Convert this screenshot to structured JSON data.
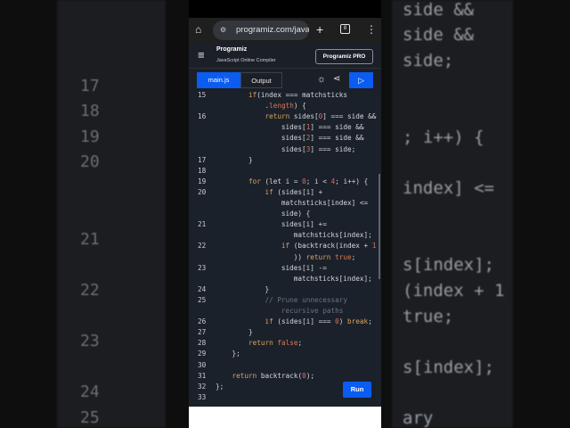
{
  "background": {
    "line_numbers": [
      "17",
      "18",
      "19",
      "20",
      "21",
      "22",
      "23",
      "24",
      "25"
    ],
    "code": [
      "side &&",
      "side &&",
      "side;",
      "; i++) {",
      "index] <=",
      "s[index];",
      "(index + 1",
      "true;",
      "s[index];",
      "ary"
    ]
  },
  "browser": {
    "url": "programiz.com/javasc",
    "tab_count": "8"
  },
  "header": {
    "logo": "Programiz",
    "subtitle": "JavaScript Online Compiler",
    "pro_button": "Programiz PRO"
  },
  "toolbar": {
    "tab_main": "main.js",
    "tab_output": "Output"
  },
  "editor": {
    "run_label": "Run",
    "rows": [
      {
        "ln": "15",
        "i": 8,
        "s": [
          [
            "k",
            "if"
          ],
          [
            "",
            "(index === matchsticks"
          ]
        ]
      },
      {
        "ln": "",
        "i": 12,
        "s": [
          [
            "",
            "."
          ],
          [
            "b",
            "length"
          ],
          [
            "",
            ") {"
          ]
        ]
      },
      {
        "ln": "16",
        "i": 12,
        "s": [
          [
            "k",
            "return"
          ],
          [
            "",
            " sides["
          ],
          [
            "n",
            "0"
          ],
          [
            "",
            "] === side &&"
          ]
        ]
      },
      {
        "ln": "",
        "i": 16,
        "s": [
          [
            "",
            "sides["
          ],
          [
            "n",
            "1"
          ],
          [
            "",
            "] === side &&"
          ]
        ]
      },
      {
        "ln": "",
        "i": 16,
        "s": [
          [
            "",
            "sides["
          ],
          [
            "n",
            "2"
          ],
          [
            "",
            "] === side &&"
          ]
        ]
      },
      {
        "ln": "",
        "i": 16,
        "s": [
          [
            "",
            "sides["
          ],
          [
            "n",
            "3"
          ],
          [
            "",
            "] === side;"
          ]
        ]
      },
      {
        "ln": "17",
        "i": 8,
        "s": [
          [
            "",
            "}"
          ]
        ]
      },
      {
        "ln": "18",
        "i": 0,
        "s": []
      },
      {
        "ln": "19",
        "i": 8,
        "s": [
          [
            "k",
            "for"
          ],
          [
            "",
            " (let i = "
          ],
          [
            "n",
            "0"
          ],
          [
            "",
            "; i < "
          ],
          [
            "n",
            "4"
          ],
          [
            "",
            "; i++) {"
          ]
        ]
      },
      {
        "ln": "20",
        "i": 12,
        "s": [
          [
            "k",
            "if"
          ],
          [
            "",
            " (sides[i] +"
          ]
        ]
      },
      {
        "ln": "",
        "i": 16,
        "s": [
          [
            "",
            "matchsticks[index] <="
          ]
        ]
      },
      {
        "ln": "",
        "i": 16,
        "s": [
          [
            "",
            "side) {"
          ]
        ]
      },
      {
        "ln": "21",
        "i": 16,
        "s": [
          [
            "",
            "sides[i] +="
          ]
        ]
      },
      {
        "ln": "",
        "i": 19,
        "s": [
          [
            "",
            "matchsticks[index];"
          ]
        ]
      },
      {
        "ln": "22",
        "i": 16,
        "s": [
          [
            "k",
            "if"
          ],
          [
            "",
            " (backtrack(index + "
          ],
          [
            "n",
            "1"
          ]
        ]
      },
      {
        "ln": "",
        "i": 19,
        "s": [
          [
            "",
            "))"
          ],
          [
            "k",
            " return"
          ],
          [
            "b",
            " true"
          ],
          [
            "",
            ";"
          ]
        ]
      },
      {
        "ln": "23",
        "i": 16,
        "s": [
          [
            "",
            "sides[i] -="
          ]
        ]
      },
      {
        "ln": "",
        "i": 19,
        "s": [
          [
            "",
            "matchsticks[index];"
          ]
        ]
      },
      {
        "ln": "24",
        "i": 12,
        "s": [
          [
            "",
            "}"
          ]
        ]
      },
      {
        "ln": "25",
        "i": 12,
        "s": [
          [
            "c",
            "// Prune unnecessary"
          ]
        ]
      },
      {
        "ln": "",
        "i": 16,
        "s": [
          [
            "c",
            "recursive paths"
          ]
        ]
      },
      {
        "ln": "26",
        "i": 12,
        "s": [
          [
            "k",
            "if"
          ],
          [
            "",
            " (sides[i] === "
          ],
          [
            "n",
            "0"
          ],
          [
            "",
            ") "
          ],
          [
            "k",
            "break"
          ],
          [
            "",
            ";"
          ]
        ]
      },
      {
        "ln": "27",
        "i": 8,
        "s": [
          [
            "",
            "}"
          ]
        ]
      },
      {
        "ln": "28",
        "i": 8,
        "s": [
          [
            "k",
            "return"
          ],
          [
            "b",
            " false"
          ],
          [
            "",
            ";"
          ]
        ]
      },
      {
        "ln": "29",
        "i": 4,
        "s": [
          [
            "",
            "};"
          ]
        ]
      },
      {
        "ln": "30",
        "i": 0,
        "s": []
      },
      {
        "ln": "31",
        "i": 4,
        "s": [
          [
            "k",
            "return"
          ],
          [
            "",
            " backtrack("
          ],
          [
            "n",
            "0"
          ],
          [
            "",
            ");"
          ]
        ]
      },
      {
        "ln": "32",
        "i": 0,
        "s": [
          [
            "",
            "};"
          ]
        ]
      },
      {
        "ln": "33",
        "i": 0,
        "s": []
      }
    ]
  }
}
